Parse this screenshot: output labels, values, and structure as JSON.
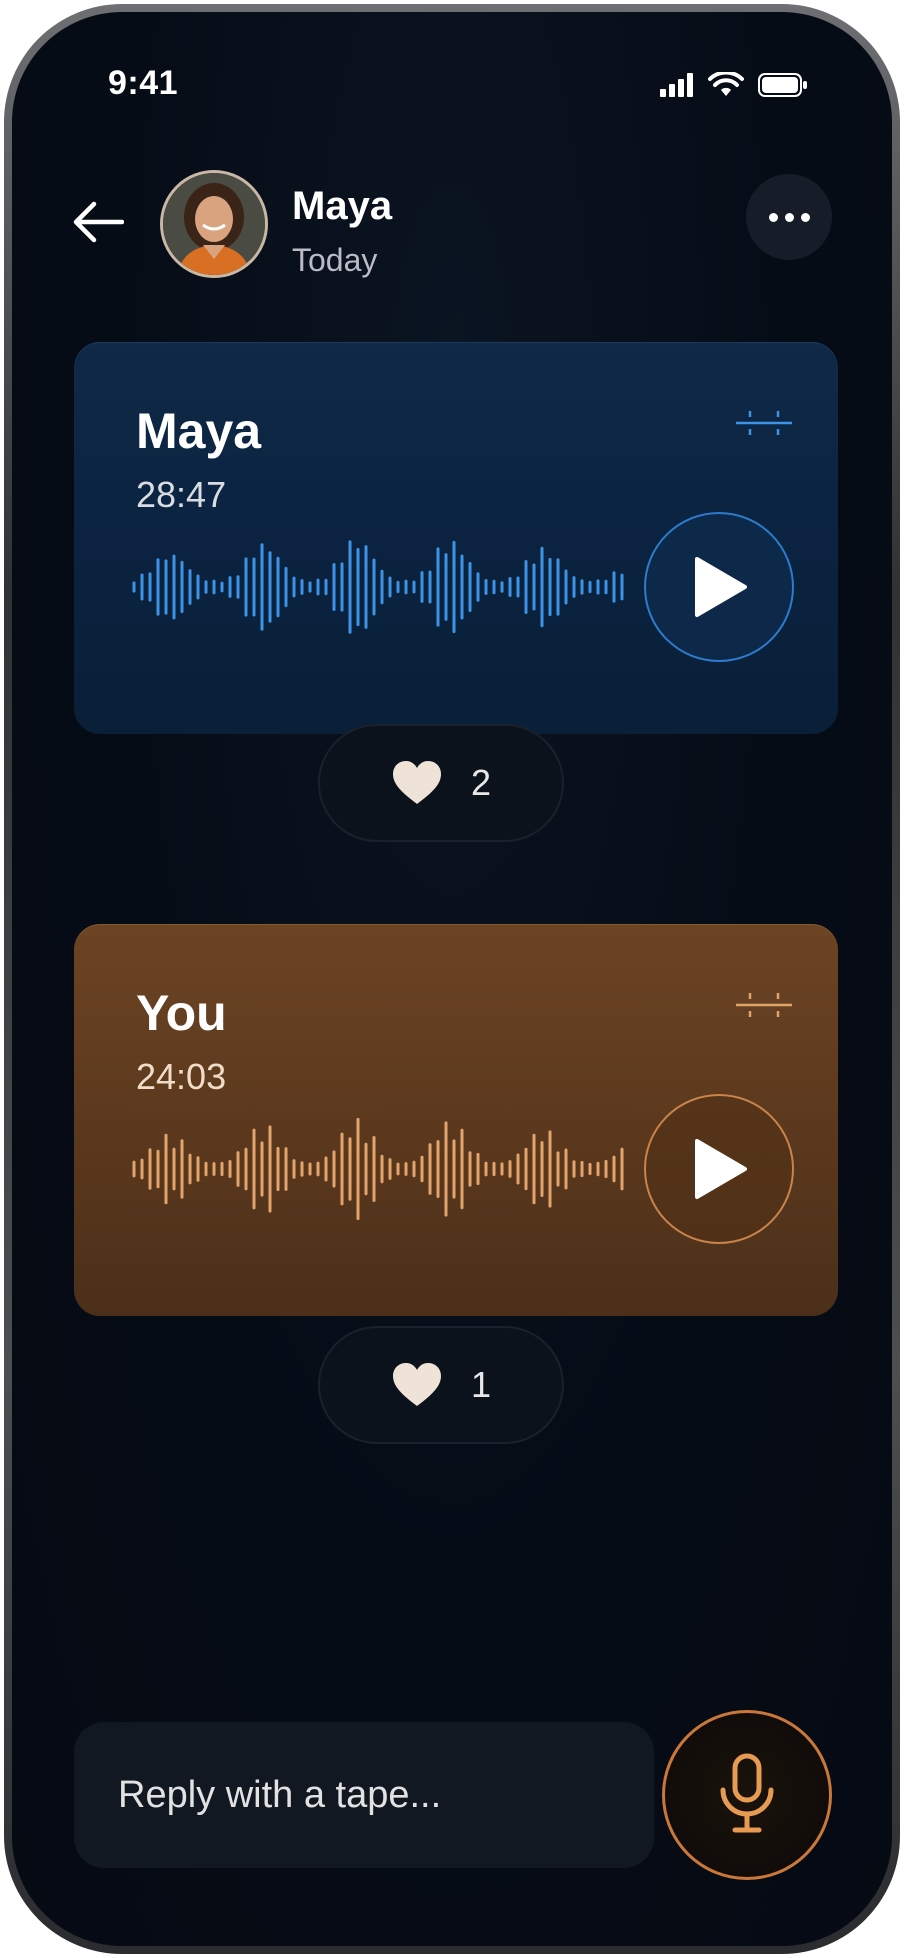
{
  "status": {
    "time": "9:41"
  },
  "header": {
    "contact_name": "Maya",
    "contact_subtitle": "Today",
    "avatar_icon": "person-photo",
    "back_icon": "arrow-left-icon",
    "more_icon": "ellipsis-icon"
  },
  "tapes": [
    {
      "sender": "Maya",
      "duration": "28:47",
      "likes": "2",
      "accent": "#3d93e6"
    },
    {
      "sender": "You",
      "duration": "24:03",
      "likes": "1",
      "accent": "#e2a46b"
    }
  ],
  "reply": {
    "placeholder": "Reply with a tape..."
  },
  "colors": {
    "blue_card": "#0b2442",
    "orange_card": "#5e3a1e",
    "mic_ring": "#c9783a",
    "background": "#060c16"
  }
}
